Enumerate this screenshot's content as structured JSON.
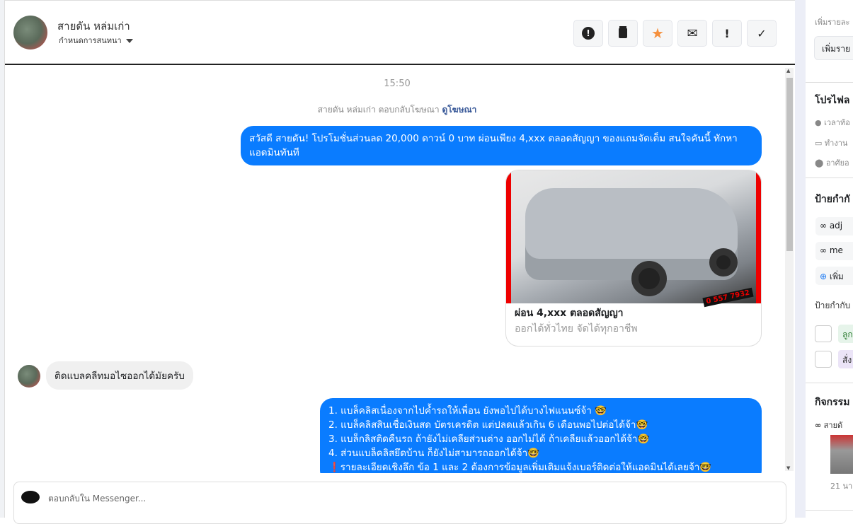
{
  "header": {
    "contact_name": "สายดัน หล่มเก่า",
    "assign_label": "กำหนดการสนทนา",
    "actions": [
      {
        "name": "spam",
        "icon": "⬢"
      },
      {
        "name": "delete",
        "icon": "🗑"
      },
      {
        "name": "star",
        "icon": "★"
      },
      {
        "name": "mark-unread",
        "icon": "✉"
      },
      {
        "name": "follow-up",
        "icon": "!"
      },
      {
        "name": "done",
        "icon": "✓"
      }
    ]
  },
  "chat": {
    "time": "15:50",
    "reply_info": "สายดัน หล่มเก่า ตอบกลับโฆษณา",
    "view_ad": "ดูโฆษณา",
    "msg1": "สวัสดี สายดัน! โปรโมชั่นส่วนลด 20,000 ดาวน์ 0 บาท ผ่อนเพียง 4,xxx ตลอดสัญญา ของแถมจัดเต็ม สนใจคันนี้ ทักหาแอดมินทันที",
    "card": {
      "title": "ผ่อน 4,xxx ตลอดสัญญา",
      "subtitle": "ออกได้ทั่วไทย จัดได้ทุกอาชีพ",
      "phone": "0 557 7932"
    },
    "incoming": "ติดแบลคลีทมอไซออกได้มัยครับ",
    "reply_lines": [
      "1. แบล็คลิสเนื่องจากไปค้ำรถให้เพื่อน ยังพอไปได้บางไฟแนนซ์จ้า 🤓",
      "2. แบล็คลิสสินเชื่อเงินสด บัตรเครดิต แต่ปลดแล้วเกิน 6 เดือนพอไปต่อได้จ้า🤓",
      "3. แบล็กลิสติดคืนรถ ถ้ายังไม่เคลียส่วนต่าง ออกไม่ได้ ถ้าเคลียแล้วออกได้จ้า🤓",
      "4. ส่วนแบล็คลิสยึดบ้าน ก็ยังไม่สามารถออกได้จ้า🤓",
      "❗รายละเอียดเชิงลึก ข้อ 1 และ 2 ต้องการข้อมูลเพิ่มเติมแจ้งเบอร์ติดต่อให้แอดมินได้เลยจ้า🤓"
    ]
  },
  "composer": {
    "placeholder": "ตอบกลับใน Messenger..."
  },
  "sidebar": {
    "details_hint": "เพิ่มรายละ",
    "details_button": "เพิ่มราย",
    "profile_title": "โปรไฟล",
    "local_time": "เวลาท้อ",
    "work": "ทำงาน",
    "lives": "อาศัยอ",
    "labels_title": "ป้ายกำกั",
    "label1": "adj",
    "label2": "me",
    "add_label": "เพิ่ม",
    "labels_sub": "ป้ายกำกับ",
    "chip1": "ลูก",
    "chip2": "สั่ง",
    "activity_title": "กิจกรรม",
    "activity_item": "สายดั",
    "activity_time": "21 นา"
  }
}
